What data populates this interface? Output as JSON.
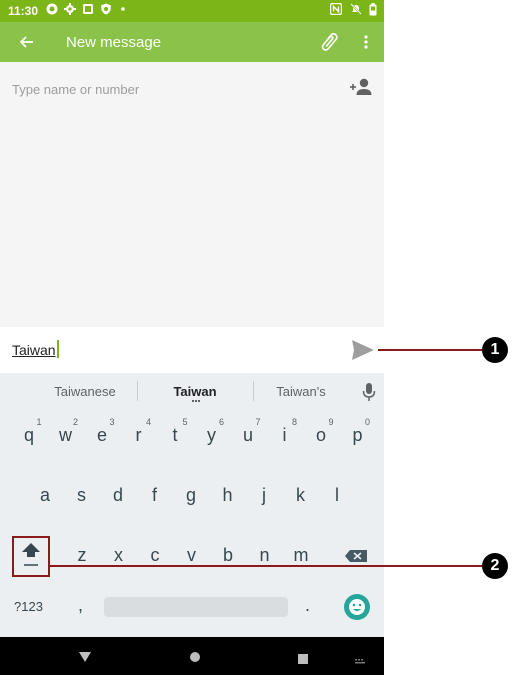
{
  "status_bar": {
    "time": "11:30",
    "left_icons": [
      "notification-icon",
      "settings-icon",
      "image-icon",
      "shield-icon",
      "dot-icon"
    ],
    "right_icons": [
      "nfc-icon",
      "mute-icon",
      "battery-icon"
    ]
  },
  "app_bar": {
    "title": "New message",
    "back_icon": "back-arrow-icon",
    "attach_icon": "paperclip-icon",
    "more_icon": "more-vert-icon"
  },
  "recipient": {
    "placeholder": "Type name or number",
    "value": ""
  },
  "compose": {
    "text": "Taiwan"
  },
  "keyboard": {
    "suggestions": [
      "Taiwanese",
      "Taiwan",
      "Taiwan's"
    ],
    "row1": [
      "q",
      "w",
      "e",
      "r",
      "t",
      "y",
      "u",
      "i",
      "o",
      "p"
    ],
    "row1_hints": [
      "1",
      "2",
      "3",
      "4",
      "5",
      "6",
      "7",
      "8",
      "9",
      "0"
    ],
    "row2": [
      "a",
      "s",
      "d",
      "f",
      "g",
      "h",
      "j",
      "k",
      "l"
    ],
    "row3": [
      "z",
      "x",
      "c",
      "v",
      "b",
      "n",
      "m"
    ],
    "symbols_label": "?123",
    "comma": ",",
    "period": "."
  },
  "callouts": {
    "one": "1",
    "two": "2"
  },
  "colors": {
    "app_bar": "#8bc34a",
    "status_bar": "#7cb518",
    "callout_line": "#8b1a1a",
    "emoji_key": "#26a69a"
  }
}
